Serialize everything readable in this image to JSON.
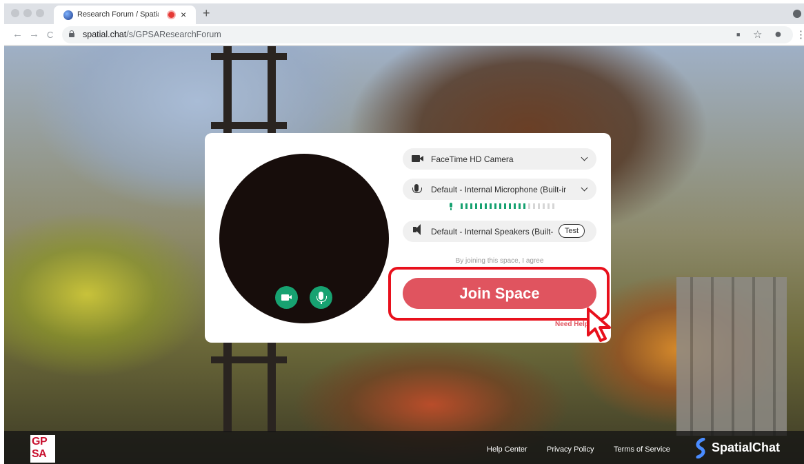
{
  "browser": {
    "tab_title": "Research Forum / SpatialC",
    "close_glyph": "×",
    "new_tab_glyph": "+",
    "url_host": "spatial.chat",
    "url_path": "/s/GPSAResearchForum",
    "back_glyph": "←",
    "forward_glyph": "→",
    "reload_glyph": "C",
    "camera_glyph": "■",
    "star_glyph": "☆",
    "profile_glyph": "●",
    "menu_glyph": "⋮"
  },
  "dialog": {
    "camera_label": "FaceTime HD Camera",
    "microphone_label": "Default - Internal Microphone (Built-in)",
    "speakers_label": "Default - Internal Speakers (Built-in)",
    "test_label": "Test",
    "mic_level": 0.7,
    "agree_text": "By joining this space, I agree",
    "join_label": "Join Space",
    "need_help_label": "Need Help?"
  },
  "footer": {
    "logo_text": "GP SA",
    "help_center": "Help Center",
    "privacy_policy": "Privacy Policy",
    "terms_of_service": "Terms of Service",
    "brand_name": "SpatialChat"
  },
  "colors": {
    "accent_red": "#e0545f",
    "highlight_red": "#e8101c",
    "device_green": "#17a271"
  }
}
